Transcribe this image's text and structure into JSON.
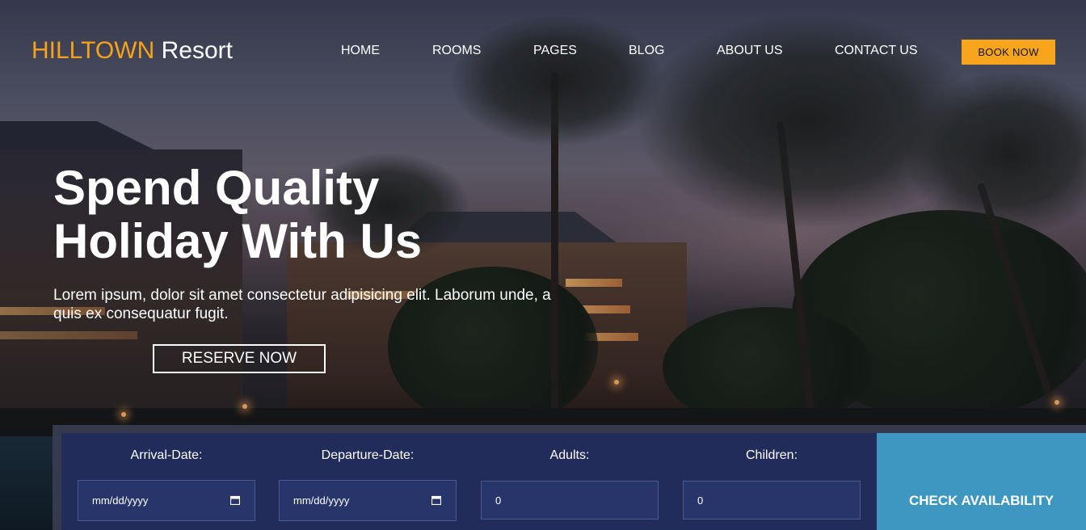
{
  "brand": {
    "name_accent": "HILLTOWN",
    "name_rest": "Resort",
    "accent_color": "#f7a21b"
  },
  "nav": {
    "items": [
      {
        "label": "HOME"
      },
      {
        "label": "ROOMS"
      },
      {
        "label": "PAGES"
      },
      {
        "label": "BLOG"
      },
      {
        "label": "ABOUT US"
      },
      {
        "label": "CONTACT US"
      }
    ],
    "book_label": "BOOK NOW",
    "book_color": "#f7a51c"
  },
  "hero": {
    "title_line1": "Spend Quality",
    "title_line2": "Holiday With Us",
    "text": "Lorem ipsum, dolor sit amet consectetur adipisicing elit. Laborum unde, a quis ex consequatur fugit.",
    "cta_label": "RESERVE NOW"
  },
  "booking": {
    "arrival_label": "Arrival-Date:",
    "arrival_value": "mm/dd/yyyy",
    "departure_label": "Departure-Date:",
    "departure_value": "mm/dd/yyyy",
    "adults_label": "Adults:",
    "adults_value": "0",
    "children_label": "Children:",
    "children_value": "0",
    "submit_label": "CHECK AVAILABILITY",
    "panel_color": "#222c5a",
    "submit_color": "#3d97c1"
  },
  "icons": {
    "calendar": "calendar-icon"
  }
}
